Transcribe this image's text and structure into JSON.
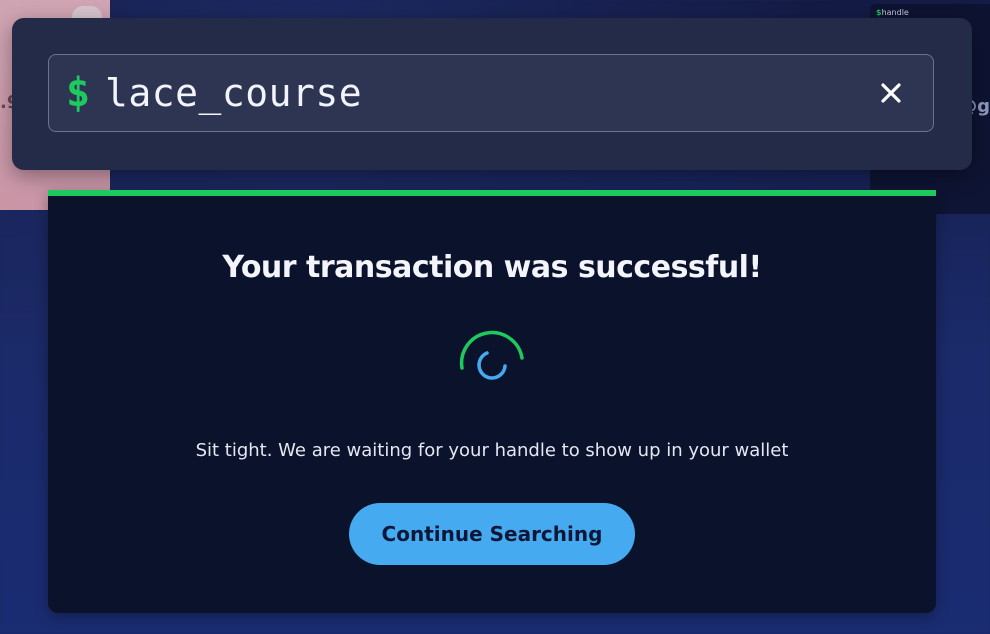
{
  "search": {
    "prefix_icon": "dollar-sign-icon",
    "value": "lace_course",
    "clear_icon": "close-icon"
  },
  "result": {
    "title": "Your transaction was successful!",
    "message": "Sit tight. We are waiting for your handle to show up in your wallet",
    "continue_label": "Continue Searching",
    "spinner_icon": "loading-spinner-icon"
  },
  "background": {
    "right_card_label": "handle",
    "left_edge_text": ".9",
    "right_edge_text": "@g"
  },
  "colors": {
    "accent_green": "#1ec95e",
    "accent_blue": "#46aaf0",
    "card_bg": "#0b122b",
    "panel_bg": "#232b48"
  }
}
